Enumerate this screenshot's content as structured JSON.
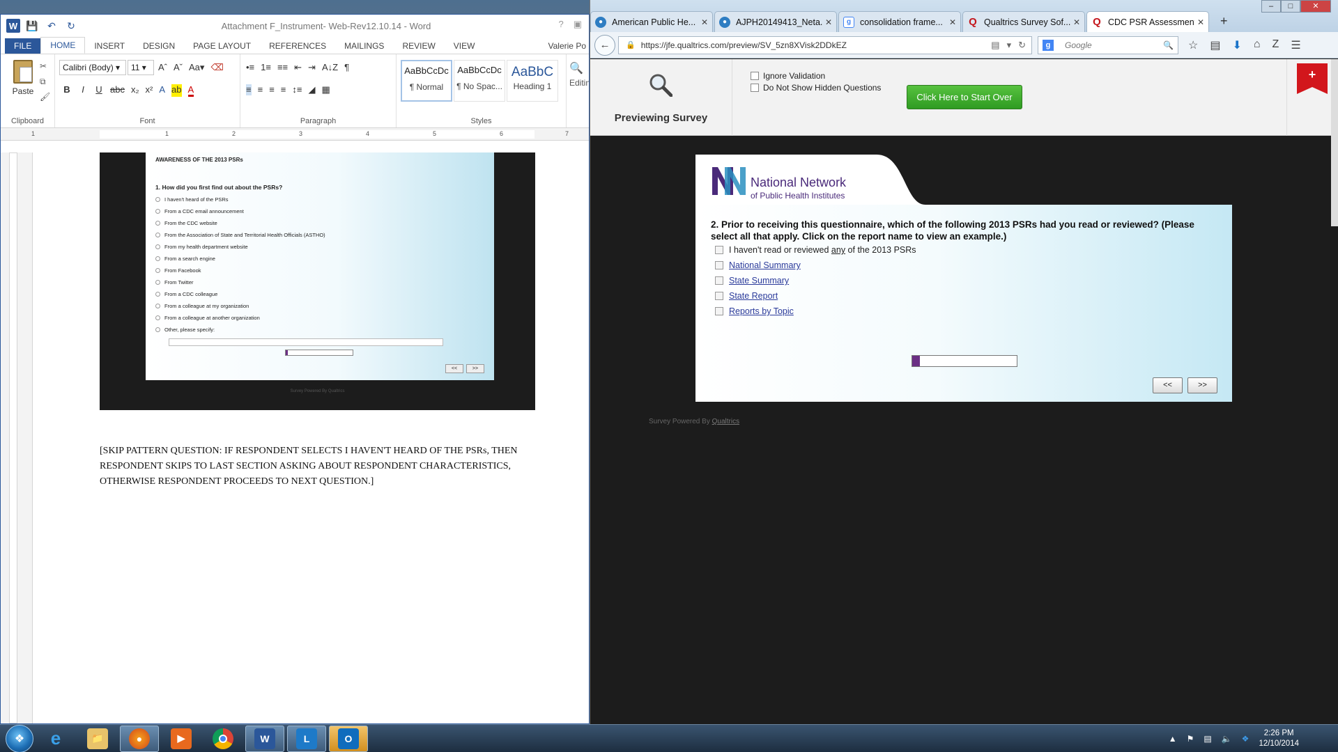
{
  "word": {
    "title": "Attachment F_Instrument- Web-Rev12.10.14 - Word",
    "user": "Valerie Po",
    "tabs": [
      "FILE",
      "HOME",
      "INSERT",
      "DESIGN",
      "PAGE LAYOUT",
      "REFERENCES",
      "MAILINGS",
      "REVIEW",
      "VIEW"
    ],
    "ribbon": {
      "paste_label": "Paste",
      "font_name": "Calibri (Body)",
      "font_size": "11",
      "groups": [
        "Clipboard",
        "Font",
        "Paragraph",
        "Styles"
      ],
      "styles": [
        {
          "sample": "AaBbCcDc",
          "name": "¶ Normal"
        },
        {
          "sample": "AaBbCcDc",
          "name": "¶ No Spac..."
        },
        {
          "sample": "AaBbC",
          "name": "Heading 1"
        }
      ],
      "editing_label": "Editin"
    },
    "ruler_numbers": [
      "1",
      "1",
      "2",
      "3",
      "4",
      "5",
      "6",
      "7"
    ],
    "embedded_survey": {
      "section_heading": "AWARENESS OF THE 2013 PSRs",
      "question": "1. How did you first find out about the PSRs?",
      "options": [
        "I haven't heard of the PSRs",
        "From a CDC email announcement",
        "From the CDC website",
        "From the Association of State and Territorial Health Officials (ASTHO)",
        "From my health department website",
        "From a search engine",
        "From Facebook",
        "From Twitter",
        "From a CDC colleague",
        "From a colleague at my organization",
        "From a colleague at another organization",
        "Other, please specify:"
      ],
      "prev": "<<",
      "next": ">>",
      "footer": "Survey Powered By Qualtrics"
    },
    "body_text": "[SKIP PATTERN QUESTION: IF RESPONDENT SELECTS I HAVEN'T HEARD OF THE PSRs, THEN RESPONDENT SKIPS TO LAST SECTION ASKING ABOUT RESPONDENT CHARACTERISTICS, OTHERWISE RESPONDENT PROCEEDS TO NEXT QUESTION.]"
  },
  "browser": {
    "tabs": [
      {
        "label": "American Public He...",
        "icon": "globe-icon",
        "active": false
      },
      {
        "label": "AJPH20149413_Neta...",
        "icon": "globe-icon",
        "active": false
      },
      {
        "label": "consolidation frame...",
        "icon": "google-icon",
        "active": false
      },
      {
        "label": "Qualtrics Survey Sof...",
        "icon": "qualtrics-icon",
        "active": false
      },
      {
        "label": "CDC PSR Assessment",
        "icon": "qualtrics-icon",
        "active": true
      }
    ],
    "url": "https://jfe.qualtrics.com/preview/SV_5zn8XVisk2DDkEZ",
    "search_placeholder": "Google"
  },
  "preview": {
    "label": "Previewing Survey",
    "ignore_validation": "Ignore Validation",
    "hide_hidden": "Do Not Show Hidden Questions",
    "start_over": "Click Here to Start Over"
  },
  "survey": {
    "org_name": "National Network",
    "org_sub": "of Public Health Institutes",
    "question": "2. Prior to receiving this questionnaire, which of the following 2013 PSRs had you read or reviewed? (Please select all that apply. Click on the report name to view an example.)",
    "option_none_pre": "I haven't read or reviewed ",
    "option_none_em": "any",
    "option_none_post": " of the 2013 PSRs",
    "options": [
      "National Summary",
      "State Summary",
      "State Report",
      "Reports by Topic"
    ],
    "progress_fraction": 0.07,
    "prev": "<<",
    "next": ">>",
    "powered_by": "Survey Powered By",
    "powered_link": "Qualtrics"
  },
  "taskbar": {
    "time": "2:26 PM",
    "date": "12/10/2014"
  },
  "colors": {
    "word_blue": "#2b579a",
    "qualtrics_purple": "#6b2f84",
    "start_green": "#3aa82a"
  }
}
